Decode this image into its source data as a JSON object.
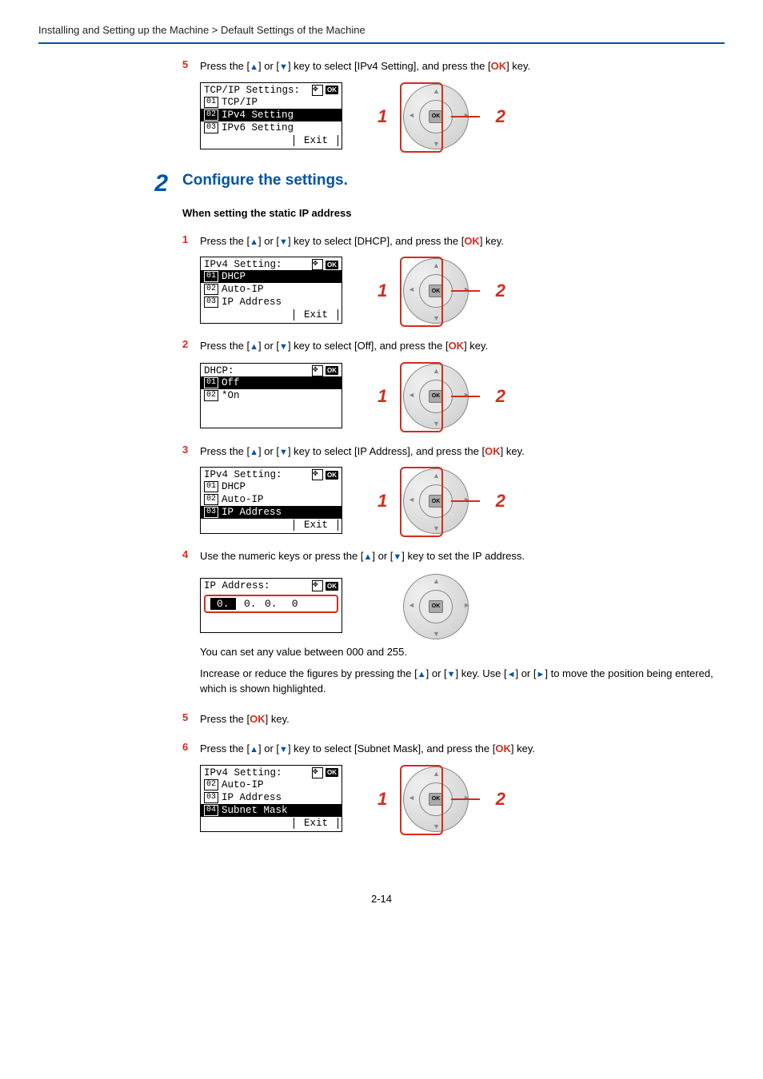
{
  "header": {
    "breadcrumb": "Installing and Setting up the Machine > Default Settings of the Machine"
  },
  "step5_top": {
    "num": "5",
    "text_parts": [
      "Press the [",
      "▲",
      "] or [",
      "▼",
      "] key to select [IPv4 Setting], and press the [",
      "OK",
      "] key."
    ],
    "lcd_title": "TCP/IP Settings:",
    "rows": [
      {
        "n": "01",
        "t": "TCP/IP"
      },
      {
        "n": "02",
        "t": "IPv4 Setting",
        "hl": true
      },
      {
        "n": "03",
        "t": "IPv6 Setting"
      }
    ],
    "exit": "Exit",
    "callouts": [
      "1",
      "2"
    ]
  },
  "big2": {
    "num": "2",
    "title": "Configure the settings.",
    "subtitle": "When setting the static IP address"
  },
  "sub1": {
    "num": "1",
    "text_parts": [
      "Press the [",
      "▲",
      "] or [",
      "▼",
      "] key to select [DHCP], and press the [",
      "OK",
      "] key."
    ],
    "lcd_title": "IPv4 Setting:",
    "rows": [
      {
        "n": "01",
        "t": "DHCP",
        "hl": true
      },
      {
        "n": "02",
        "t": "Auto-IP"
      },
      {
        "n": "03",
        "t": "IP Address"
      }
    ],
    "exit": "Exit",
    "callouts": [
      "1",
      "2"
    ]
  },
  "sub2": {
    "num": "2",
    "text_parts": [
      "Press the [",
      "▲",
      "] or [",
      "▼",
      "] key to select [Off], and press the [",
      "OK",
      "] key."
    ],
    "lcd_title": "DHCP:",
    "rows": [
      {
        "n": "01",
        "t": "Off",
        "hl": true
      },
      {
        "n": "02",
        "t": "*On"
      }
    ],
    "callouts": [
      "1",
      "2"
    ]
  },
  "sub3": {
    "num": "3",
    "text_parts": [
      "Press the [",
      "▲",
      "] or [",
      "▼",
      "] key to select [IP Address], and press the [",
      "OK",
      "] key."
    ],
    "lcd_title": "IPv4 Setting:",
    "rows": [
      {
        "n": "01",
        "t": "DHCP"
      },
      {
        "n": "02",
        "t": "Auto-IP"
      },
      {
        "n": "03",
        "t": "IP Address",
        "hl": true
      }
    ],
    "exit": "Exit",
    "callouts": [
      "1",
      "2"
    ]
  },
  "sub4": {
    "num": "4",
    "text_parts": [
      "Use the numeric keys or press the [",
      "▲",
      "] or [",
      "▼",
      "] key to set the IP address."
    ],
    "lcd_title": "IP Address:",
    "ip_segments": [
      "0.",
      "0.",
      "0.",
      "0"
    ],
    "note": "You can set any value between 000 and 255.",
    "note2_parts": [
      "Increase or reduce the figures by pressing the [",
      "▲",
      "] or [",
      "▼",
      "] key. Use [",
      "◄",
      "] or [",
      "►",
      "] to move the position being entered, which is shown highlighted."
    ]
  },
  "sub5": {
    "num": "5",
    "text_parts": [
      "Press the [",
      "OK",
      "] key."
    ]
  },
  "sub6": {
    "num": "6",
    "text_parts": [
      "Press the [",
      "▲",
      "] or [",
      "▼",
      "] key to select [Subnet Mask], and press the [",
      "OK",
      "] key."
    ],
    "lcd_title": "IPv4 Setting:",
    "rows": [
      {
        "n": "02",
        "t": "Auto-IP"
      },
      {
        "n": "03",
        "t": "IP Address"
      },
      {
        "n": "04",
        "t": "Subnet Mask",
        "hl": true
      }
    ],
    "exit": "Exit",
    "callouts": [
      "1",
      "2"
    ]
  },
  "page": "2-14"
}
